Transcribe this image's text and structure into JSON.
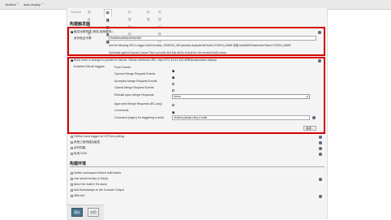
{
  "breadcrumb": {
    "items": [
      "Jenkins",
      "auto-deploy"
    ]
  },
  "tabs": [
    "General",
    "源码管理",
    "构建触发器",
    "构建环境",
    "构建",
    "构建后操作"
  ],
  "sections": {
    "triggers_title": "构建触发器",
    "env_title": "构建环境"
  },
  "remote_trigger": {
    "label": "触发远程构建 (例如,使用脚本)",
    "token_label": "身份验证令牌",
    "token_value": "84b3b9caff0a01e94e4f1b",
    "help_line1": "Use the following URL to trigger build remotely: JENKINS_URL/job/auto-deploy/build?token=TOKEN_NAME 或者 /buildWithParameters?token=TOKEN_NAME",
    "help_line2": "Optionally append &cause=Cause+Text to provide text that will be included in the recorded build cause."
  },
  "gitlab": {
    "label": "Build when a change is pushed to GitLab. GitLab webhook URL: http://172.16.41.161:8080/project/auto-deploy",
    "triggers_label": "Enabled GitLab triggers",
    "push_events": "Push Events",
    "opened_mr": "Opened Merge Request Events",
    "accepted_mr": "Accepted Merge Request Events",
    "closed_mr": "Closed Merge Request Events",
    "rebuild_label": "Rebuild open Merge Requests",
    "rebuild_value": "Never",
    "approved_mr": "Approved Merge Requests (EE-only)",
    "comments": "Comments",
    "comment_regex_label": "Comment (regex) for triggering a build",
    "comment_regex_value": "Jenkins please retry a build",
    "advanced_button": "高级..."
  },
  "other_triggers": [
    "GitHub hook trigger for GITScm polling",
    "其他工程构建后触发",
    "定时构建",
    "轮询 SCM"
  ],
  "env_options": [
    "Delete workspace before build starts",
    "Use secret text(s) or file(s)",
    "Abort the build if it's stuck",
    "Add timestamps to the Console Output",
    "With Ant"
  ],
  "buttons": {
    "save": "保存",
    "apply": "应用"
  },
  "colors": {
    "highlight": "#d40000",
    "primary": "#4b758b"
  }
}
